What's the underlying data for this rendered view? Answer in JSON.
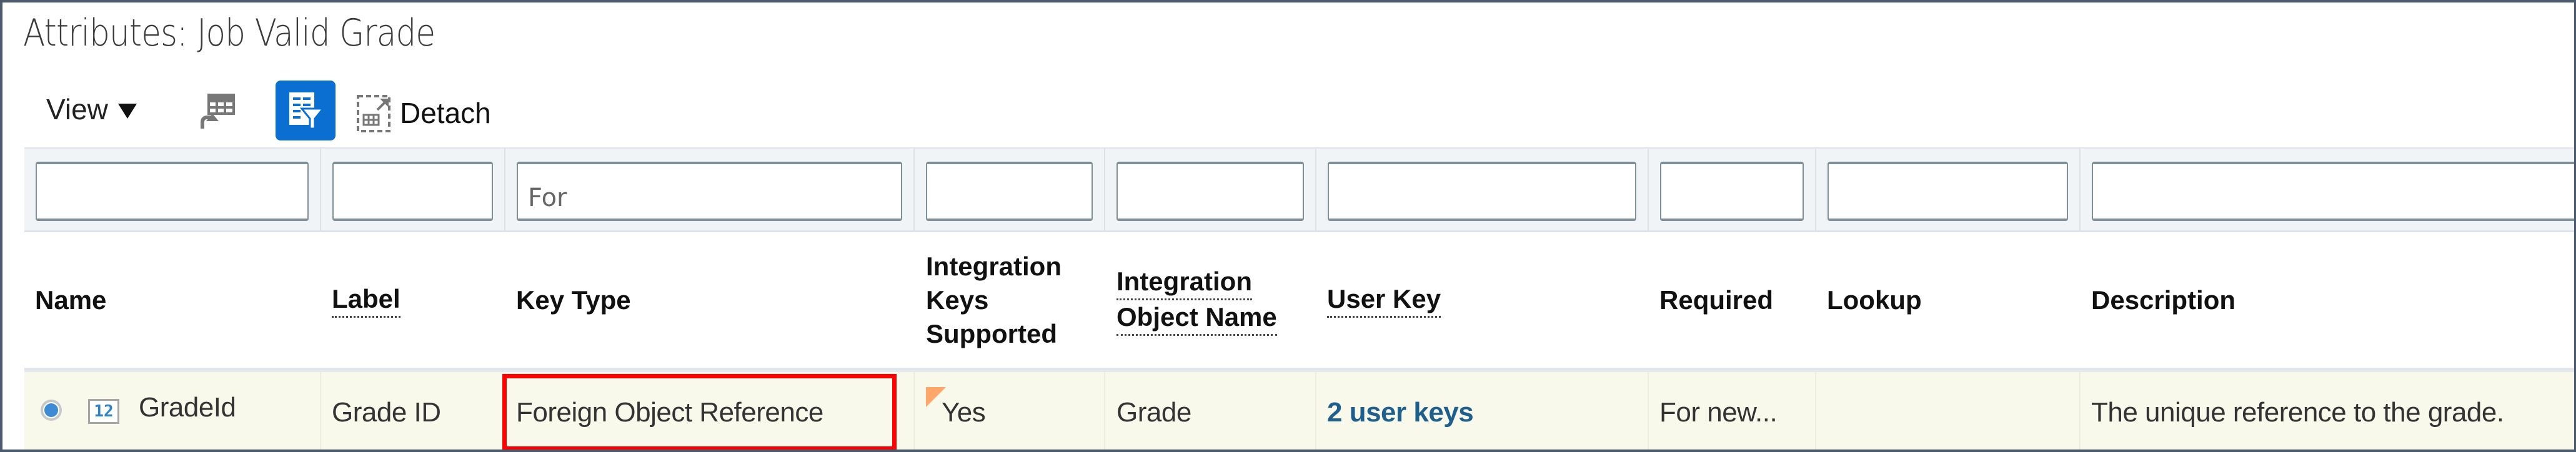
{
  "page": {
    "title": "Attributes: Job Valid Grade"
  },
  "toolbar": {
    "view_label": "View",
    "view_caret_icon": "caret-down-icon",
    "freeze_icon": "freeze-table-icon",
    "query_by_example_icon": "query-by-example-icon",
    "query_by_example_active": true,
    "detach_icon": "detach-icon",
    "detach_label": "Detach",
    "accent_color": "#0a6fd1"
  },
  "filters": [
    {
      "column": "Name",
      "value": "",
      "placeholder": ""
    },
    {
      "column": "Label",
      "value": "",
      "placeholder": ""
    },
    {
      "column": "Key Type",
      "value": "For",
      "placeholder": ""
    },
    {
      "column": "Integration Keys Supported",
      "value": "",
      "placeholder": ""
    },
    {
      "column": "Integration Object Name",
      "value": "",
      "placeholder": ""
    },
    {
      "column": "User Key",
      "value": "",
      "placeholder": ""
    },
    {
      "column": "Required",
      "value": "",
      "placeholder": ""
    },
    {
      "column": "Lookup",
      "value": "",
      "placeholder": ""
    },
    {
      "column": "Description",
      "value": "",
      "placeholder": ""
    }
  ],
  "columns": [
    {
      "label": "Name",
      "lines": [
        "Name"
      ],
      "has_help": false
    },
    {
      "label": "Label",
      "lines": [
        "Label"
      ],
      "has_help": true
    },
    {
      "label": "Key Type",
      "lines": [
        "Key Type"
      ],
      "has_help": false
    },
    {
      "label": "Integration Keys Supported",
      "lines": [
        "Integration",
        "Keys",
        "Supported"
      ],
      "has_help": false
    },
    {
      "label": "Integration Object Name",
      "lines": [
        "Integration",
        "Object Name"
      ],
      "has_help": true
    },
    {
      "label": "User Key",
      "lines": [
        "User Key"
      ],
      "has_help": true
    },
    {
      "label": "Required",
      "lines": [
        "Required"
      ],
      "has_help": false
    },
    {
      "label": "Lookup",
      "lines": [
        "Lookup"
      ],
      "has_help": false
    },
    {
      "label": "Description",
      "lines": [
        "Description"
      ],
      "has_help": false
    }
  ],
  "rows": [
    {
      "selected": true,
      "type_icon": "number-type-icon",
      "type_icon_text": "12",
      "name": "GradeId",
      "label": "Grade ID",
      "key_type": "Foreign Object Reference",
      "integration_keys_supported": "Yes",
      "integration_keys_changed": true,
      "integration_object_name": "Grade",
      "user_key": "2 user keys",
      "required": "For new...",
      "lookup": "",
      "description": "The unique reference to the grade."
    }
  ],
  "annotations": {
    "highlight": {
      "column": "Key Type",
      "row": 0,
      "color": "#ff0000"
    }
  },
  "colors": {
    "frame_border": "#4b5a6d",
    "filter_row_bg": "#f1f4f7",
    "selected_row_bg": "#f9f9eb",
    "link": "#1f5f8b",
    "changed_marker": "#ffa66a"
  }
}
